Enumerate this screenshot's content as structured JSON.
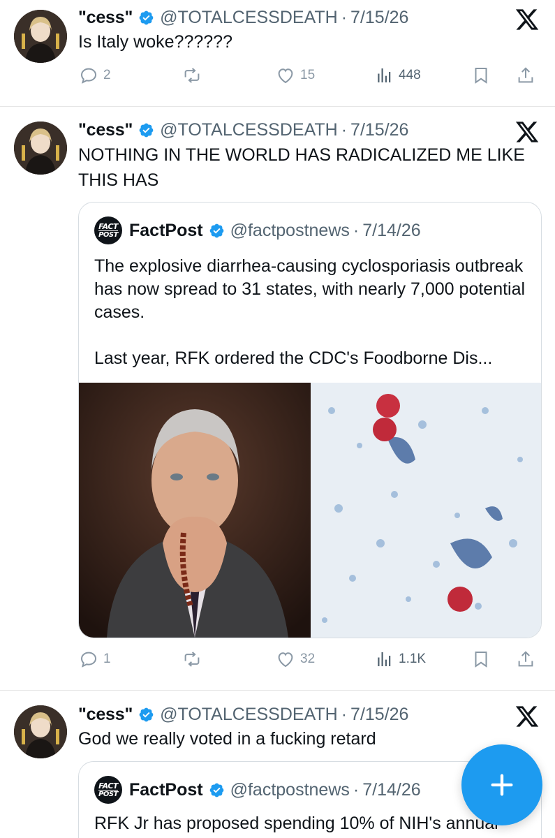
{
  "tweets": [
    {
      "name": "\"cess\"",
      "handle": "@TOTALCESSDEATH",
      "sep": "·",
      "date": "7/15/26",
      "text": "Is Italy woke??????",
      "stats": {
        "replies": "2",
        "reposts": "",
        "likes": "15",
        "views": "448"
      }
    },
    {
      "name": "\"cess\"",
      "handle": "@TOTALCESSDEATH",
      "sep": "·",
      "date": "7/15/26",
      "text": "NOTHING IN THE WORLD HAS RADICALIZED ME LIKE THIS HAS",
      "quote": {
        "logo_line1": "FACT",
        "logo_line2": "POST",
        "name": "FactPost",
        "handle": "@factpostnews",
        "sep": "·",
        "date": "7/14/26",
        "para1": "The explosive diarrhea-causing cyclosporiasis outbreak has now spread to 31 states, with nearly 7,000 potential cases.",
        "para2": "Last year, RFK ordered the CDC's Foodborne Dis..."
      },
      "stats": {
        "replies": "1",
        "reposts": "",
        "likes": "32",
        "views": "1.1K"
      }
    },
    {
      "name": "\"cess\"",
      "handle": "@TOTALCESSDEATH",
      "sep": "·",
      "date": "7/15/26",
      "text": "God we really voted in a fucking retard",
      "quote": {
        "logo_line1": "FACT",
        "logo_line2": "POST",
        "name": "FactPost",
        "handle": "@factpostnews",
        "sep": "·",
        "date": "7/14/26",
        "para1": "RFK Jr has proposed spending 10% of NIH's annual"
      }
    }
  ],
  "colors": {
    "accent": "#1d9bf0",
    "muted": "#536471",
    "text": "#0f1419"
  },
  "icons": [
    "verified-badge-icon",
    "x-logo-icon",
    "reply-icon",
    "repost-icon",
    "like-icon",
    "views-icon",
    "bookmark-icon",
    "share-icon",
    "compose-icon"
  ]
}
